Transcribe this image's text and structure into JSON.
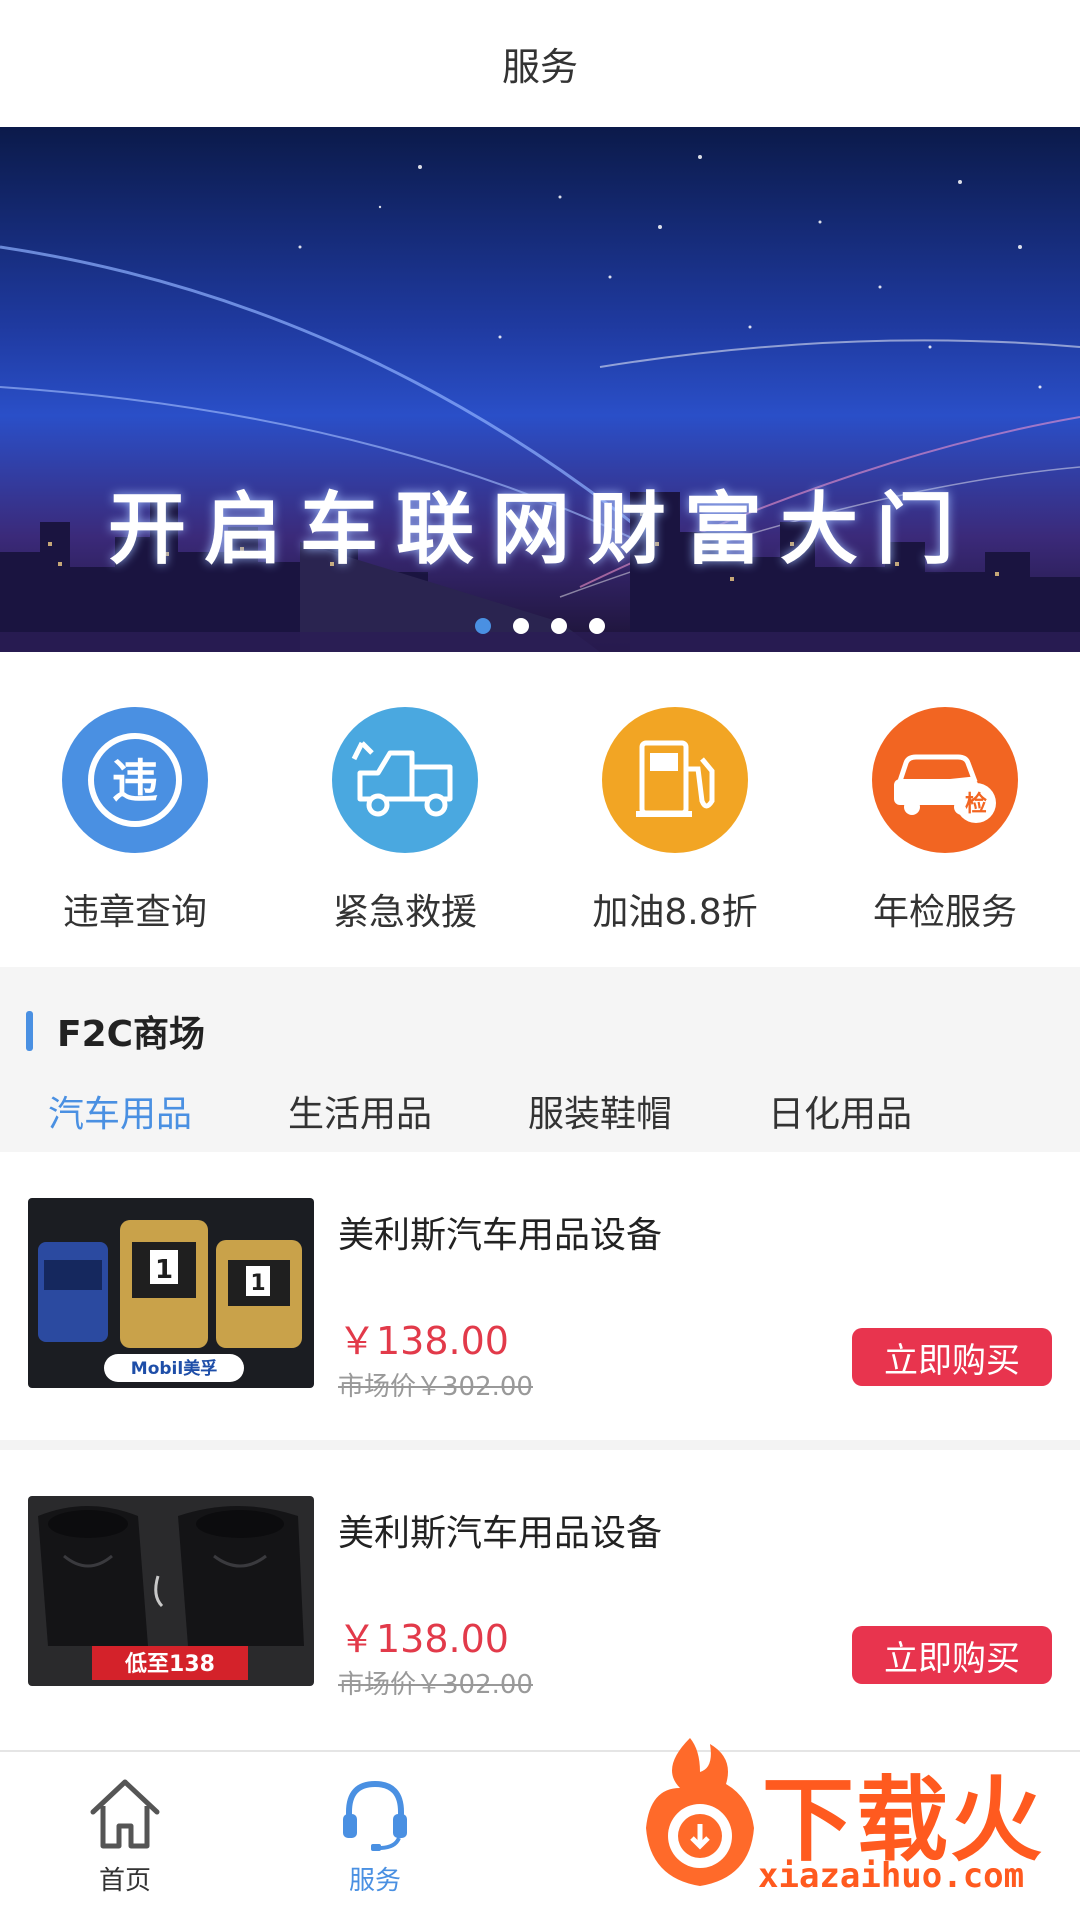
{
  "header": {
    "title": "服务"
  },
  "banner": {
    "headline": "开启车联网财富大门",
    "slide_count": 4,
    "active_slide": 1
  },
  "services": [
    {
      "label": "违章查询",
      "icon": "violation-icon",
      "glyph": "违",
      "color": "#4a90e2"
    },
    {
      "label": "紧急救援",
      "icon": "tow-truck-icon",
      "color": "#4aa8e0"
    },
    {
      "label": "加油8.8折",
      "icon": "fuel-pump-icon",
      "color": "#f2a524"
    },
    {
      "label": "年检服务",
      "icon": "car-inspection-icon",
      "glyph": "检",
      "color": "#f26522"
    }
  ],
  "mall": {
    "title": "F2C商场",
    "tabs": [
      "汽车用品",
      "生活用品",
      "服装鞋帽",
      "日化用品"
    ],
    "active_tab": 0
  },
  "products": [
    {
      "name": "美利斯汽车用品设备",
      "price": "￥138.00",
      "original_price": "市场价￥302.00",
      "buy_label": "立即购买",
      "image_badge": "Mobil美孚"
    },
    {
      "name": "美利斯汽车用品设备",
      "price": "￥138.00",
      "original_price": "市场价￥302.00",
      "buy_label": "立即购买",
      "image_badge": "低至138"
    }
  ],
  "tabbar": {
    "items": [
      {
        "label": "首页",
        "icon": "home-icon",
        "active": false
      },
      {
        "label": "服务",
        "icon": "headset-icon",
        "active": true
      }
    ]
  },
  "watermark": {
    "text": "下载火",
    "url": "xiazaihuo.com"
  }
}
